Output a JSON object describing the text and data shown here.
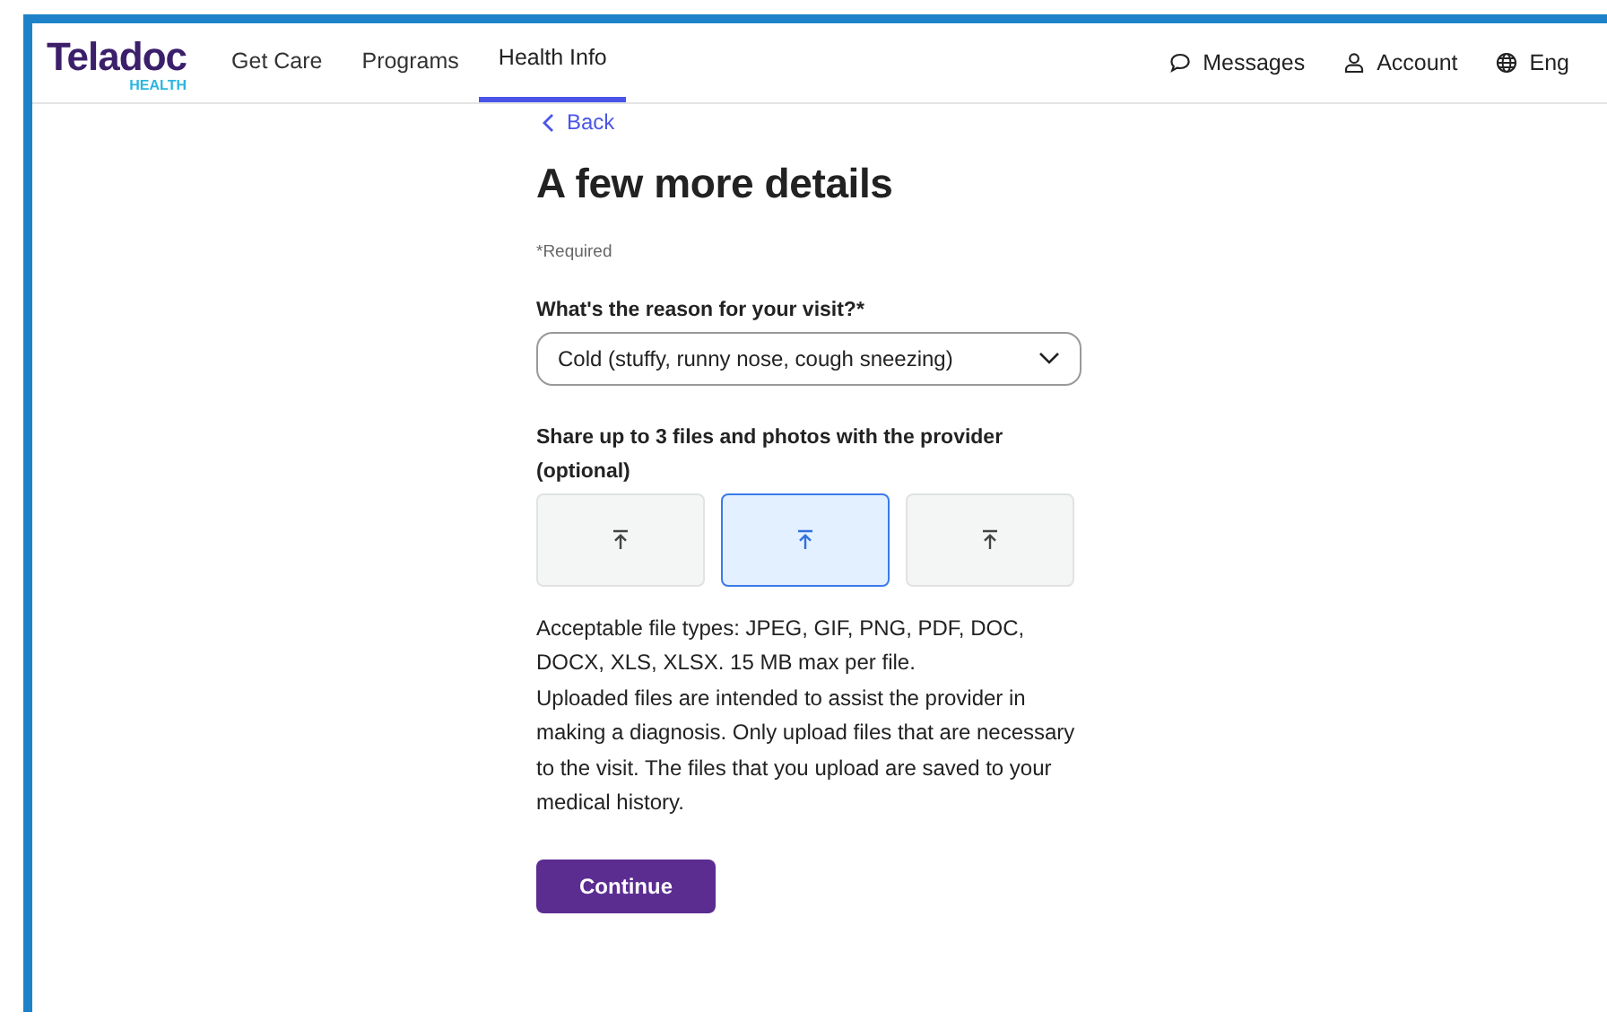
{
  "brand": {
    "name": "Teladoc",
    "sub": "HEALTH"
  },
  "nav": [
    {
      "label": "Get Care",
      "selected": false
    },
    {
      "label": "Programs",
      "selected": false
    },
    {
      "label": "Health Info",
      "selected": true
    }
  ],
  "utility": [
    {
      "kind": "messages",
      "label": "Messages"
    },
    {
      "kind": "account",
      "label": "Account"
    },
    {
      "kind": "language",
      "label": "Eng"
    }
  ],
  "back": "Back",
  "title": "A few more details",
  "required_note": "*Required",
  "reason": {
    "label": "What's the reason for your visit?*",
    "value": "Cold (stuffy, runny nose, cough sneezing)"
  },
  "uploads": {
    "label": "Share up to 3 files and photos with the provider (optional)",
    "slots": [
      {
        "selected": false
      },
      {
        "selected": true
      },
      {
        "selected": false
      }
    ]
  },
  "notes": [
    "Acceptable file types: JPEG, GIF, PNG, PDF, DOC, DOCX, XLS, XLSX. 15 MB max per file.",
    "Uploaded files are intended to assist the provider in making a diagnosis. Only upload files that are necessary to the visit. The files that you upload are saved to your medical history."
  ],
  "continue": "Continue"
}
